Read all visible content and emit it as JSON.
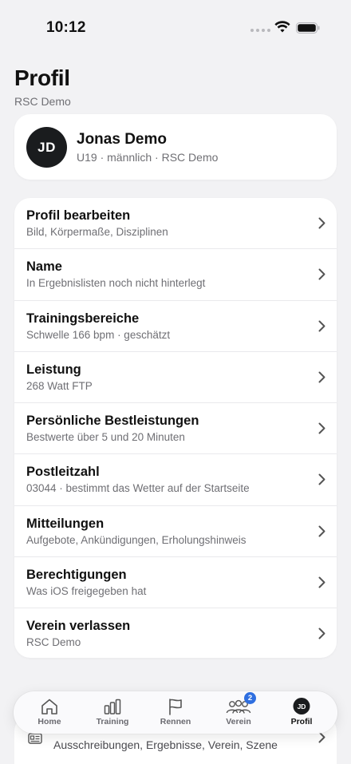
{
  "status_bar": {
    "time": "10:12"
  },
  "header": {
    "title": "Profil",
    "subtitle": "RSC Demo"
  },
  "profile": {
    "initials": "JD",
    "name": "Jonas Demo",
    "meta": "U19 · männlich · RSC Demo"
  },
  "settings": [
    {
      "title": "Profil bearbeiten",
      "subtitle": "Bild, Körpermaße, Disziplinen"
    },
    {
      "title": "Name",
      "subtitle": "In Ergebnislisten noch nicht hinterlegt"
    },
    {
      "title": "Trainingsbereiche",
      "subtitle": "Schwelle 166 bpm · geschätzt"
    },
    {
      "title": "Leistung",
      "subtitle": "268 Watt FTP"
    },
    {
      "title": "Persönliche Bestleistungen",
      "subtitle": "Bestwerte über 5 und 20 Minuten"
    },
    {
      "title": "Postleitzahl",
      "subtitle": "03044 · bestimmt das Wetter auf der Startseite"
    },
    {
      "title": "Mitteilungen",
      "subtitle": "Aufgebote, Ankündigungen, Erholungshinweis"
    },
    {
      "title": "Berechtigungen",
      "subtitle": "Was iOS freigegeben hat"
    },
    {
      "title": "Verein verlassen",
      "subtitle": "RSC Demo"
    }
  ],
  "lower_section": {
    "subtitle": "Ausschreibungen, Ergebnisse, Verein, Szene"
  },
  "tabs": [
    {
      "label": "Home",
      "icon": "home-icon"
    },
    {
      "label": "Training",
      "icon": "bar-chart-icon"
    },
    {
      "label": "Rennen",
      "icon": "flag-icon"
    },
    {
      "label": "Verein",
      "icon": "people-icon",
      "badge": "2"
    },
    {
      "label": "Profil",
      "icon": "avatar",
      "initials": "JD",
      "active": true
    }
  ],
  "colors": {
    "badge": "#2f6fe0",
    "avatar": "#1a1c1e",
    "background": "#f2f2f4"
  }
}
